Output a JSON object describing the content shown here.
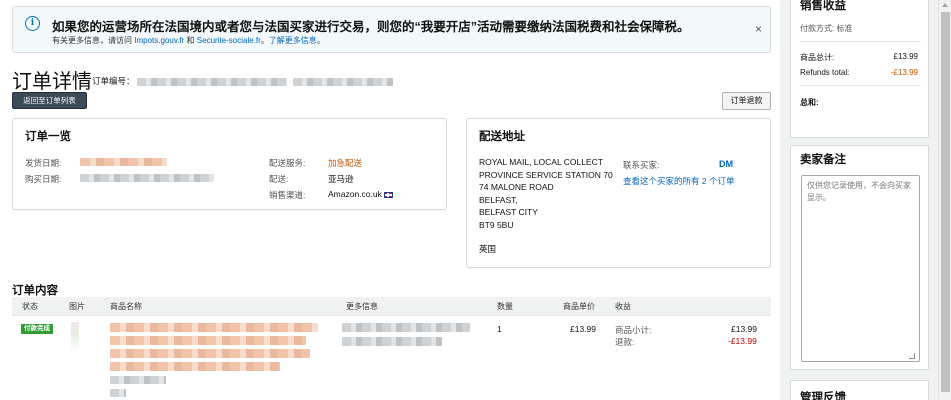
{
  "notice": {
    "title": "如果您的运营场所在法国境内或者您与法国买家进行交易，则您的“我要开店”活动需要缴纳法国税费和社会保障税。",
    "sub_prefix": "有关更多信息，请访问 ",
    "link1": "Impots.gouv.fr",
    "sub_and": " 和 ",
    "link2": "Securite-sociale.fr",
    "sub_sep": "。",
    "link3": "了解更多信息",
    "sub_end": "。",
    "close": "×"
  },
  "header": {
    "title": "订单详情",
    "order_number_label": "订单编号：",
    "back_button": "返回至订单列表",
    "refund_button": "订单退款"
  },
  "summary": {
    "title": "订单一览",
    "ship_date_label": "发货日期:",
    "purchase_date_label": "购买日期:",
    "shipping_service_label": "配送服务:",
    "shipping_service_value": "加急配送",
    "fulfillment_label": "配送:",
    "fulfillment_value": "亚马逊",
    "channel_label": "销售渠道:",
    "channel_value": "Amazon.co.uk"
  },
  "shipping": {
    "title": "配送地址",
    "address_lines": [
      "ROYAL MAIL, LOCAL COLLECT",
      "PROVINCE SERVICE STATION 70",
      "74 MALONE ROAD",
      "BELFAST,",
      "BELFAST CITY",
      "BT9 5BU"
    ],
    "country": "英国",
    "contact_label": "联系买家:",
    "contact_value": "DM",
    "all_orders_link": "查看这个买家的所有 2 个订单"
  },
  "contents": {
    "title": "订单内容",
    "columns": [
      "状态",
      "图片",
      "商品名称",
      "更多信息",
      "数量",
      "商品单价",
      "收益"
    ],
    "row": {
      "status": "付款完成",
      "quantity": "1",
      "unit_price": "£13.99",
      "subtotal_label": "商品小计:",
      "subtotal_value": "£13.99",
      "refund_label": "退款:",
      "refund_value": "-£13.99"
    }
  },
  "sales": {
    "title": "销售收益",
    "payment_method": "付款方式: 标准",
    "total_label": "商品总计:",
    "total_value": "£13.99",
    "refunds_label": "Refunds total:",
    "refunds_value": "-£13.99",
    "sum_label": "总和:"
  },
  "seller_notes": {
    "title": "卖家备注",
    "placeholder": "仅供您记录使用，不会向买家显示。"
  },
  "manage": {
    "title": "管理反馈"
  },
  "colors": {
    "link": "#0066c0",
    "orange": "#c45500",
    "refund_red": "#c40000",
    "status_green": "#2e9c32",
    "back_button": "#3a4a57"
  }
}
